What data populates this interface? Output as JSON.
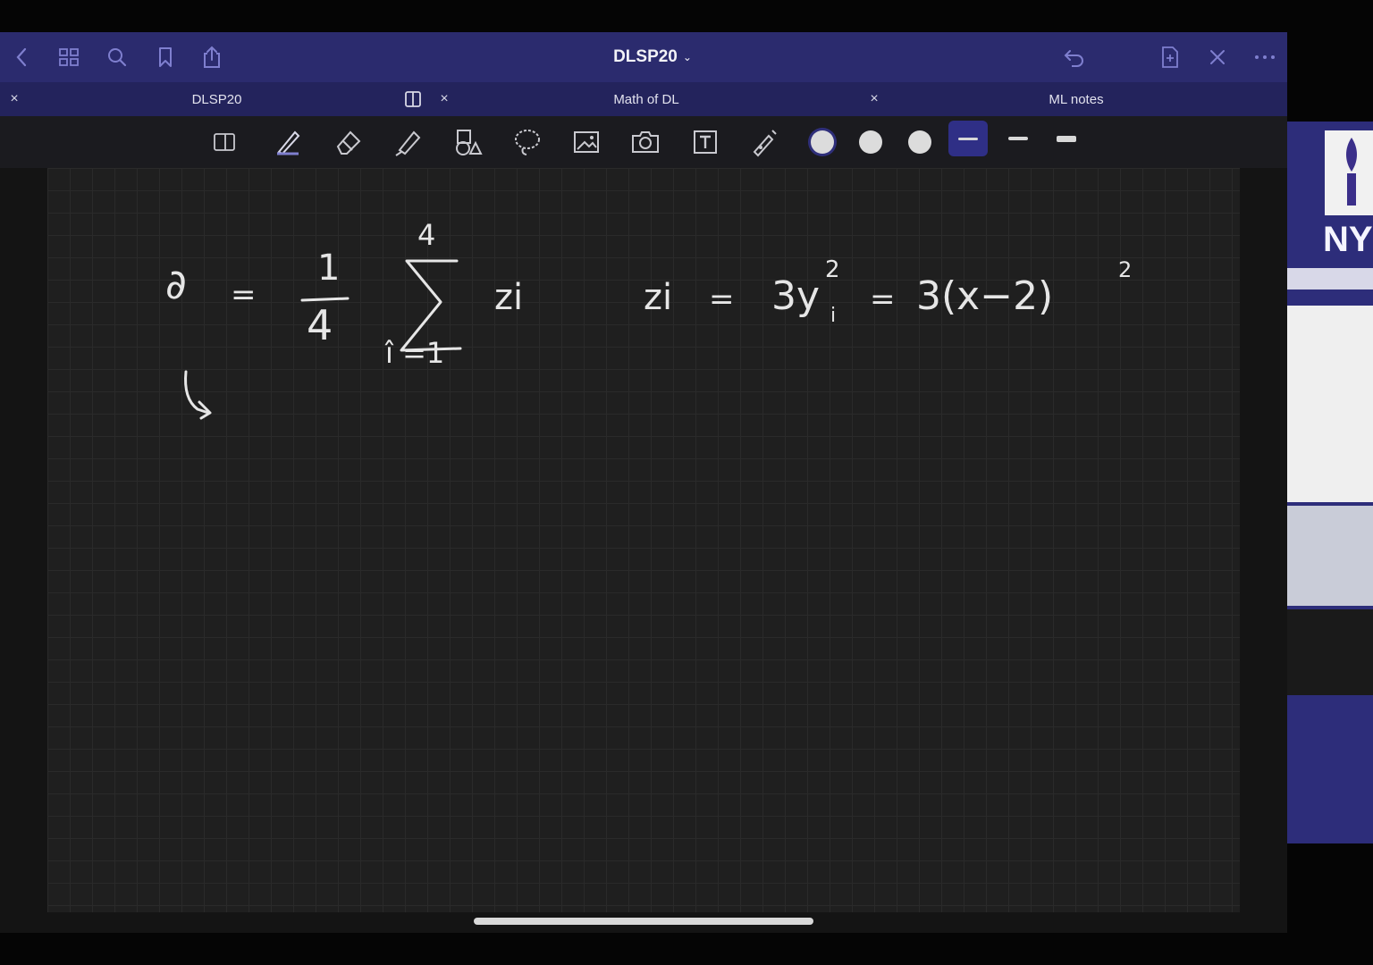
{
  "app": {
    "document_title": "DLSP20",
    "title_chevron": "⌄"
  },
  "tabs": [
    {
      "label": "DLSP20",
      "close": "×",
      "active": true
    },
    {
      "label": "Math of DL",
      "close": "×",
      "active": false
    },
    {
      "label": "ML notes",
      "close": "×",
      "active": false
    }
  ],
  "toolbar": {
    "tools": [
      "page-view",
      "pen",
      "eraser",
      "highlighter",
      "shapes",
      "lasso",
      "image",
      "camera",
      "text",
      "laser-pointer"
    ],
    "colors": [
      "#dcdcdc",
      "#dcdcdc",
      "#dcdcdc"
    ],
    "selected_color_index": 0,
    "thicknesses": [
      "thin",
      "medium",
      "thick"
    ],
    "selected_thickness_index": 0
  },
  "canvas": {
    "handwriting": {
      "lhs": "∂",
      "eq1": "=",
      "frac_num": "1",
      "frac_den": "4",
      "sum_top": "4",
      "sum_bottom": "î =1",
      "sum_term": "zi",
      "rhs_lhs": "zi",
      "eq2": "=",
      "term2": "3y",
      "term2_sup": "2",
      "term2_sub": "i",
      "eq3": "=",
      "term3": "3(x−2)",
      "term3_sup": "2"
    }
  },
  "side_panel": {
    "logo_text": "NY"
  },
  "theme": {
    "topbar": "#2b2b6e",
    "tabbar": "#23235c",
    "toolbar": "#1b1b1f",
    "canvas": "#1f1f1f",
    "side_panel": "#2d2d7a"
  }
}
